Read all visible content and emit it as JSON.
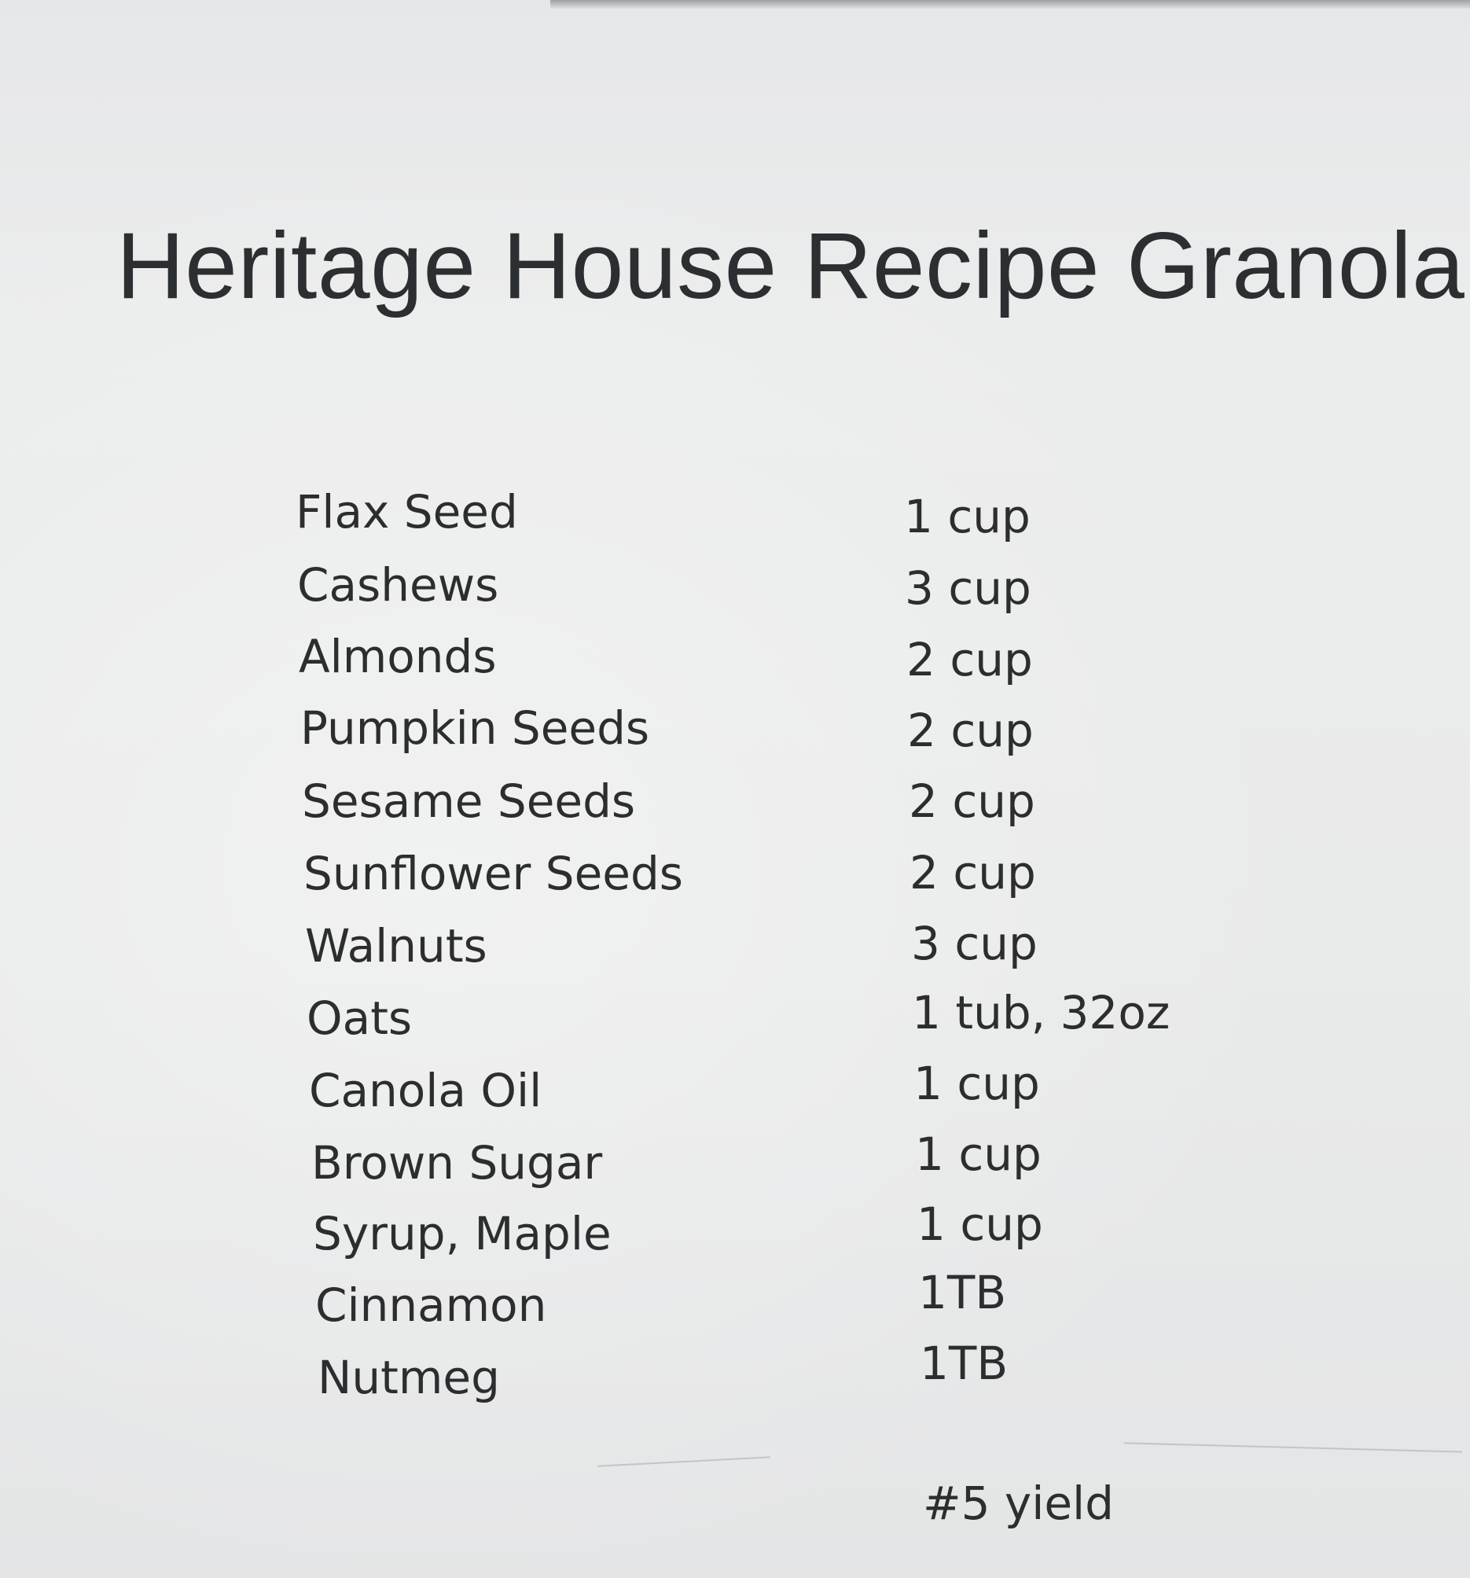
{
  "title": "Heritage House Recipe Granola",
  "ingredients": [
    {
      "name": "Flax Seed",
      "qty": "1 cup"
    },
    {
      "name": "Cashews",
      "qty": "3 cup"
    },
    {
      "name": "Almonds",
      "qty": "2 cup"
    },
    {
      "name": "Pumpkin Seeds",
      "qty": "2 cup"
    },
    {
      "name": "Sesame Seeds",
      "qty": "2 cup"
    },
    {
      "name": "Sunflower Seeds",
      "qty": "2 cup"
    },
    {
      "name": "Walnuts",
      "qty": "3 cup"
    },
    {
      "name": "Oats",
      "qty": "1 tub, 32oz"
    },
    {
      "name": "Canola Oil",
      "qty": "1 cup"
    },
    {
      "name": "Brown Sugar",
      "qty": "1 cup"
    },
    {
      "name": "Syrup, Maple",
      "qty": "1 cup"
    },
    {
      "name": "Cinnamon",
      "qty": "1TB"
    },
    {
      "name": "Nutmeg",
      "qty": "1TB"
    }
  ],
  "yield": "#5 yield"
}
